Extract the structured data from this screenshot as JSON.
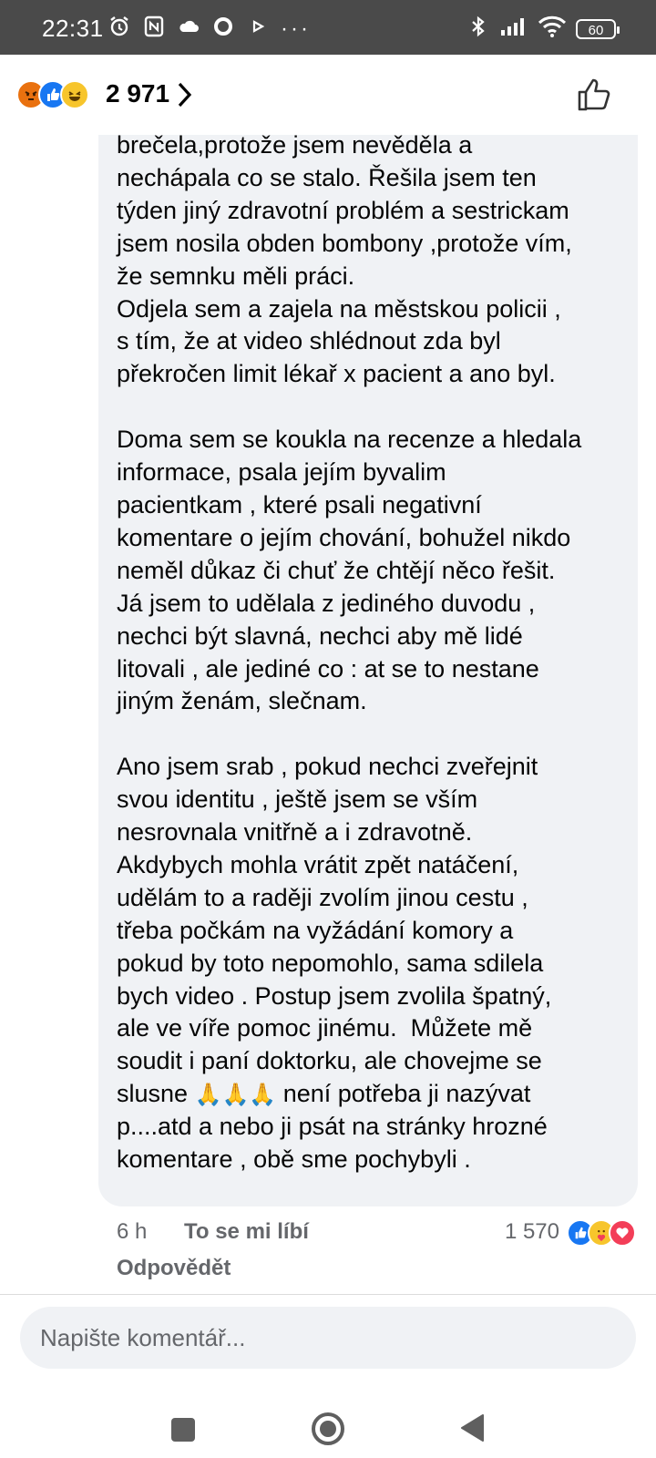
{
  "status_bar": {
    "time": "22:31",
    "battery": "60",
    "icons_left": [
      "alarm-icon",
      "nfc-icon",
      "cloud-icon",
      "circle-icon",
      "play-icon"
    ],
    "overflow": "···",
    "icons_right": [
      "bluetooth-icon",
      "signal-icon",
      "wifi-icon",
      "battery-icon"
    ]
  },
  "reactions": {
    "icons": [
      "angry-reaction-icon",
      "like-reaction-icon",
      "haha-reaction-icon"
    ],
    "count": "2 971"
  },
  "comment": {
    "text_part1": "brečela,protože jsem nevěděla a\nnechápala co se stalo. Řešila jsem ten\ntýden jiný zdravotní problém a sestrickam\njsem nosila obden bombony ,protože vím,\nže semnku měli práci.\nOdjela sem a zajela na městskou policii ,\ns tím, že at video shlédnout zda byl\npřekročen limit lékař x pacient a ano byl.\n\nDoma sem se koukla na recenze a hledala\ninformace, psala jejím byvalim\npacientkam , které psali negativní\nkomentare o jejím chování, bohužel nikdo\nneměl důkaz či chuť že chtějí něco řešit.\nJá jsem to udělala z jediného duvodu ,\nnechci být slavná, nechci aby mě lidé\nlitovali , ale jediné co : at se to nestane\njiným ženám, slečnam.\n\nAno jsem srab , pokud nechci zveřejnit\nsvou identitu , ještě jsem se vším\nnesrovnala vnitřně a i zdravotně.\nAkdybych mohla vrátit zpět natáčení,\nudělám to a raději zvolím jinou cestu ,\ntřeba počkám na vyžádání komory a\npokud by toto nepomohlo, sama sdilela\nbych video . Postup jsem zvolila špatný,\nale ve víře pomoc jinému.  Můžete mě\nsoudit i paní doktorku, ale chovejme se\nslusne ",
    "emoji": "🙏🙏🙏",
    "text_part2": " není potřeba ji nazývat\np....atd a nebo ji psát na stránky hrozné\nkomentare , obě sme pochybyli ."
  },
  "comment_meta": {
    "time": "6 h",
    "like_label": "To se mi líbí",
    "reply_label": "Odpovědět",
    "reaction_count": "1 570",
    "reaction_icons": [
      "like-reaction-icon",
      "care-reaction-icon",
      "love-reaction-icon"
    ]
  },
  "composer": {
    "placeholder": "Napište komentář..."
  },
  "nav": {
    "buttons": [
      "recents-button",
      "home-button",
      "back-button"
    ]
  },
  "colors": {
    "status_bar_bg": "#4a4a4a",
    "bubble_bg": "#f0f2f5",
    "meta_text": "#65676b",
    "like_blue": "#1877f2"
  }
}
